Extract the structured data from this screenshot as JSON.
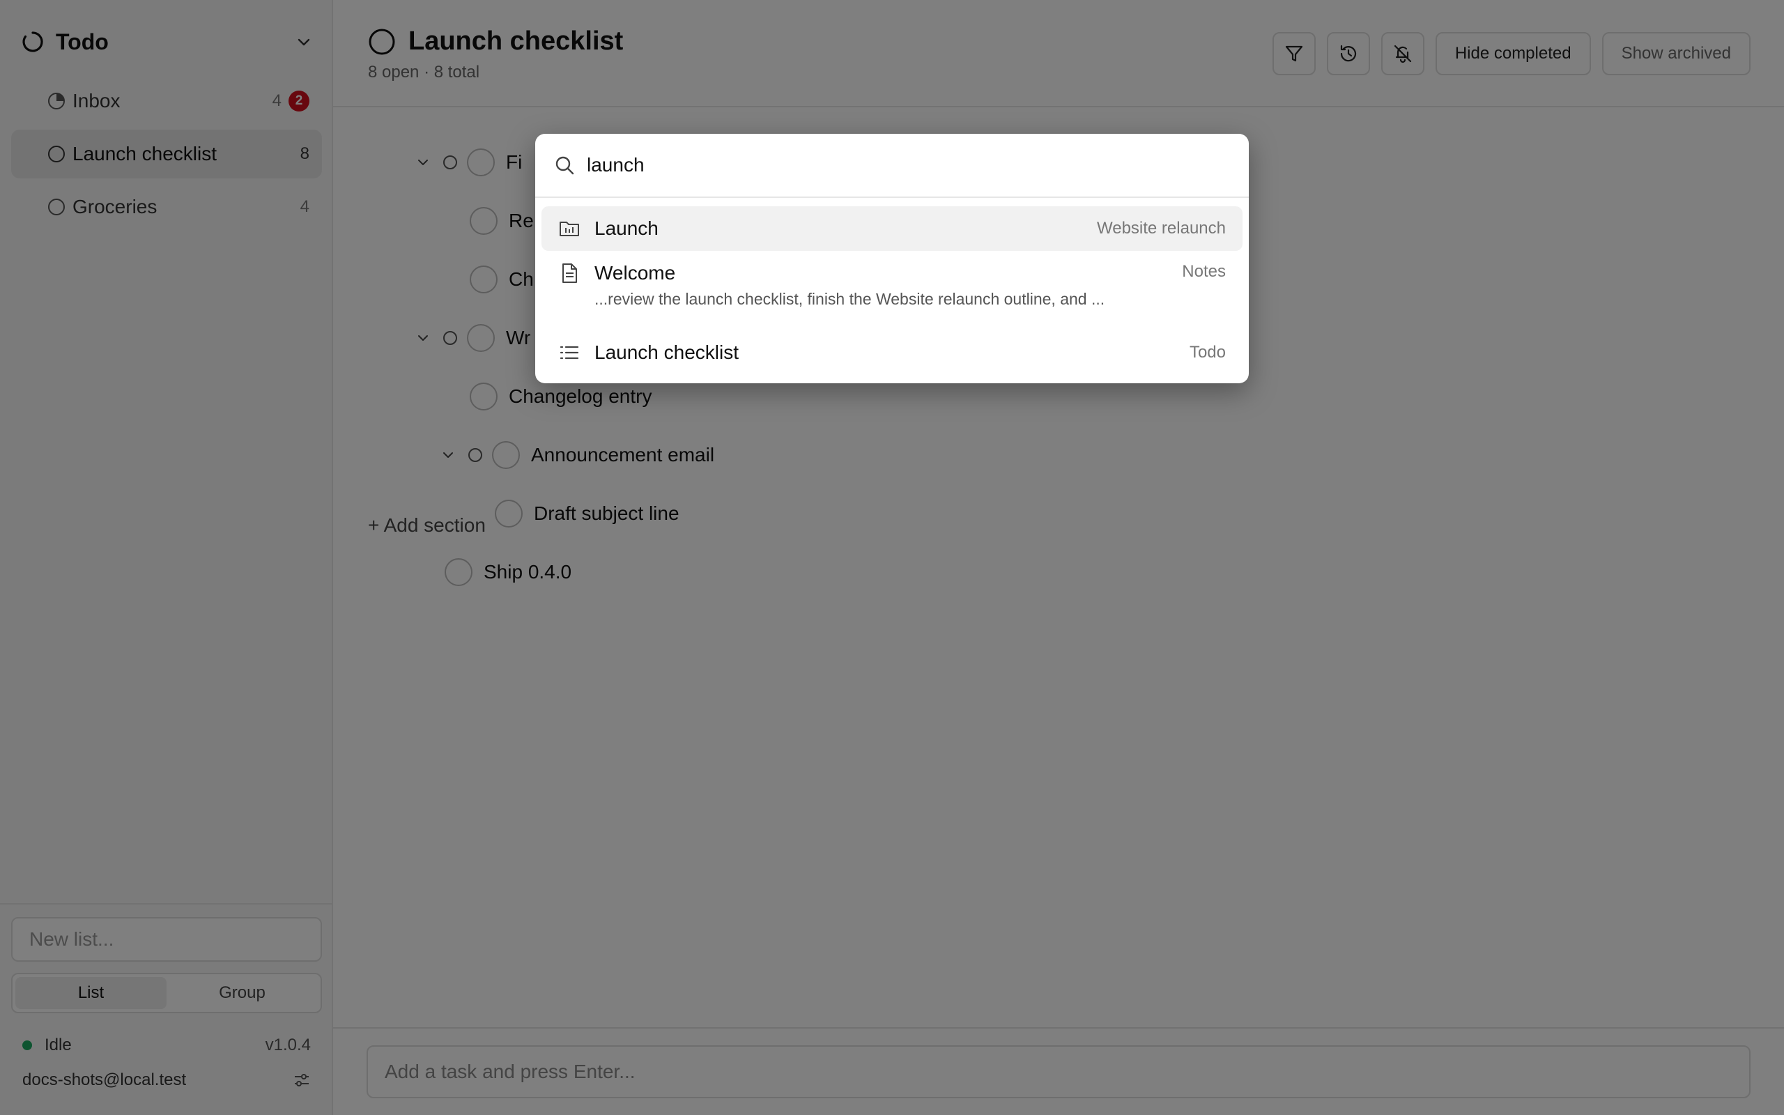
{
  "sidebar": {
    "workspace": {
      "title": "Todo"
    },
    "items": [
      {
        "label": "Inbox",
        "count": "4",
        "badge": "2"
      },
      {
        "label": "Launch checklist",
        "count": "8"
      },
      {
        "label": "Groceries",
        "count": "4"
      }
    ],
    "new_list_placeholder": "New list...",
    "view_toggle": {
      "list": "List",
      "group": "Group",
      "selected": "List"
    },
    "status": {
      "text": "Idle",
      "version": "v1.0.4",
      "color": "#1aa860"
    },
    "user": {
      "email": "docs-shots@local.test"
    }
  },
  "header": {
    "title": "Launch checklist",
    "subtitle": "8 open · 8 total",
    "hide_completed": "Hide completed",
    "show_archived": "Show archived",
    "icons": [
      "filter-icon",
      "history-icon",
      "bell-off-icon"
    ]
  },
  "tasks": [
    {
      "title": "Fi"
    },
    {
      "title": "Re"
    },
    {
      "title": "Ch"
    },
    {
      "title": "Wr"
    },
    {
      "title": "Changelog entry"
    },
    {
      "title": "Announcement email"
    },
    {
      "title": "Draft subject line"
    },
    {
      "title": "Ship 0.4.0"
    }
  ],
  "add_section": "+ Add section",
  "composer": {
    "placeholder": "Add a task and press Enter..."
  },
  "palette": {
    "query": "launch",
    "results": [
      {
        "title": "Launch",
        "meta": "Website relaunch",
        "icon": "project-folder-icon",
        "selected": true
      },
      {
        "title": "Welcome",
        "meta": "Notes",
        "snippet": "...review the launch checklist, finish the Website relaunch outline, and ...",
        "icon": "document-icon"
      },
      {
        "title": "Launch checklist",
        "meta": "Todo",
        "icon": "list-icon"
      }
    ]
  },
  "colors": {
    "badge": "#d10f1c",
    "status_dot": "#1aa860"
  }
}
